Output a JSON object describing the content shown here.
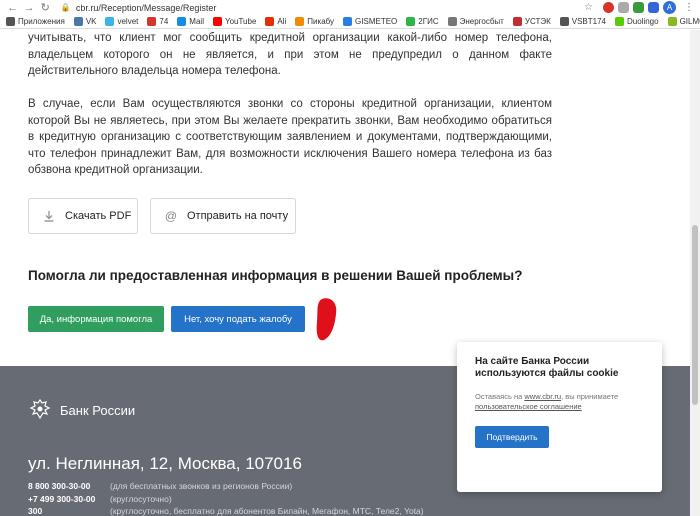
{
  "browser": {
    "url": "cbr.ru/Reception/Message/Register",
    "avatar_letter": "A"
  },
  "bookmarks": [
    {
      "label": "Приложения",
      "color": "#555555"
    },
    {
      "label": "VK",
      "color": "#4a76a8"
    },
    {
      "label": "velvet",
      "color": "#3bb5e8"
    },
    {
      "label": "74",
      "color": "#d9342b"
    },
    {
      "label": "Mail",
      "color": "#168de2"
    },
    {
      "label": "YouTube",
      "color": "#ff0000"
    },
    {
      "label": "Ali",
      "color": "#e62e04"
    },
    {
      "label": "Пикабу",
      "color": "#f28b00"
    },
    {
      "label": "GISMETEO",
      "color": "#2a7de1"
    },
    {
      "label": "2ГИС",
      "color": "#2fb44a"
    },
    {
      "label": "Энергосбыт",
      "color": "#777777"
    },
    {
      "label": "УСТЭК",
      "color": "#c03030"
    },
    {
      "label": "VSBT174",
      "color": "#555555"
    },
    {
      "label": "Duolingo",
      "color": "#58cc02"
    },
    {
      "label": "GILMON",
      "color": "#8ab820"
    }
  ],
  "content": {
    "paragraph1": "учитывать, что клиент мог сообщить кредитной организации какой-либо номер телефона, владельцем которого он не является, и при этом не предупредил о данном факте действительного владельца номера телефона.",
    "paragraph2": "В случае, если Вам осуществляются звонки со стороны кредитной организации, клиентом которой Вы не являетесь, при этом Вы желаете прекратить звонки, Вам необходимо обратиться в кредитную организацию с соответствующим заявлением и документами, подтверждающими, что телефон принадлежит Вам, для возможности исключения Вашего номера телефона из баз обзвона кредитной организации.",
    "download_pdf": "Скачать PDF",
    "send_mail": "Отправить на почту",
    "question": "Помогла ли предоставленная информация в решении Вашей проблемы?",
    "yes_button": "Да, информация помогла",
    "no_button": "Нет, хочу подать жалобу"
  },
  "footer": {
    "bank_name": "Банк России",
    "address": "ул. Неглинная, 12, Москва, 107016",
    "phones": [
      {
        "number": "8 800 300-30-00",
        "note": "(для бесплатных звонков из регионов России)"
      },
      {
        "number": "+7 499 300-30-00",
        "note": "(круглосуточно)"
      },
      {
        "number": "300",
        "note": "(круглосуточно, бесплатно для абонентов Билайн, Мегафон, МТС, Теле2, Yota)"
      }
    ]
  },
  "cookie": {
    "title": "На сайте Банка России используются файлы cookie",
    "text_prefix": "Оставаясь на ",
    "site_link": "www.cbr.ru",
    "text_middle": ", вы принимаете ",
    "agreement_link": "пользовательское соглашение",
    "confirm_button": "Подтвердить"
  },
  "colors": {
    "yes_button": "#2f9e5e",
    "no_button": "#2473c9",
    "footer_bg": "#676b73",
    "annotation_mark": "#e0101a"
  }
}
